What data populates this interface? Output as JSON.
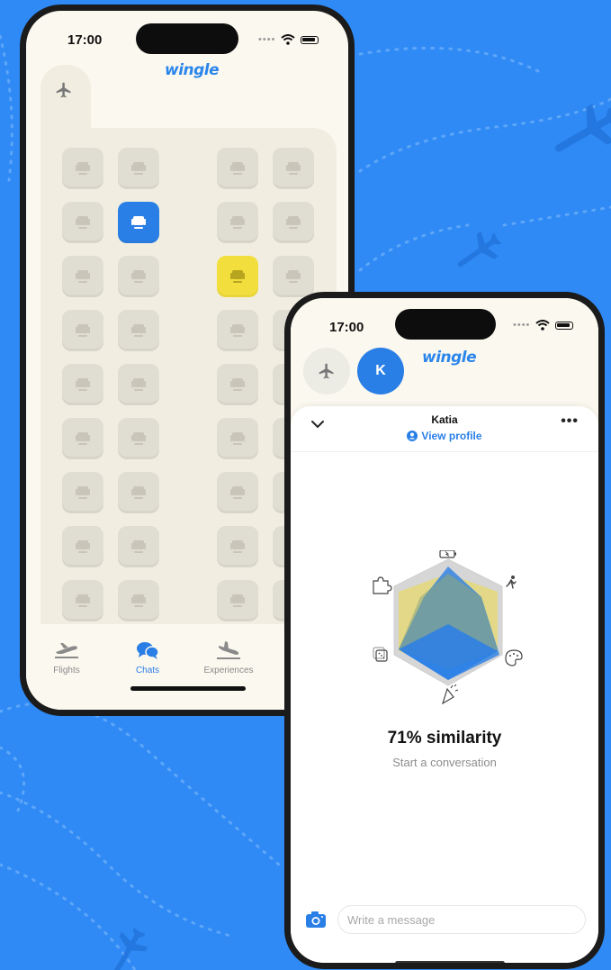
{
  "colors": {
    "background": "#2f8af5",
    "accent_blue": "#2a7fe6",
    "accent_yellow": "#f2de3c",
    "seat_gray": "#e0ddd3",
    "screen_bg": "#fbf8ef"
  },
  "phone1": {
    "status": {
      "time": "17:00",
      "icons": [
        "signal-dots-icon",
        "wifi-icon",
        "battery-icon"
      ]
    },
    "logo": "wingle",
    "seat_map": {
      "rows": 9,
      "columns": 4,
      "selected_seats": [
        {
          "row": 2,
          "col": 2,
          "state": "blue"
        },
        {
          "row": 3,
          "col": 3,
          "state": "yellow"
        }
      ]
    },
    "tabs": [
      {
        "label": "Flights",
        "icon": "plane-takeoff-icon",
        "active": false
      },
      {
        "label": "Chats",
        "icon": "chat-bubbles-icon",
        "active": true
      },
      {
        "label": "Experiences",
        "icon": "plane-landing-icon",
        "active": false
      }
    ]
  },
  "phone2": {
    "status": {
      "time": "17:00",
      "icons": [
        "signal-dots-icon",
        "wifi-icon",
        "battery-icon"
      ]
    },
    "logo": "wingle",
    "avatar_initial": "K",
    "chat": {
      "name": "Katia",
      "view_profile": "View profile",
      "similarity": "71% similarity",
      "prompt": "Start a conversation",
      "message_placeholder": "Write a message"
    },
    "radar": {
      "axes_icons": [
        "battery-icon",
        "running-icon",
        "palette-icon",
        "party-icon",
        "dice-icon",
        "puzzle-icon"
      ]
    }
  }
}
